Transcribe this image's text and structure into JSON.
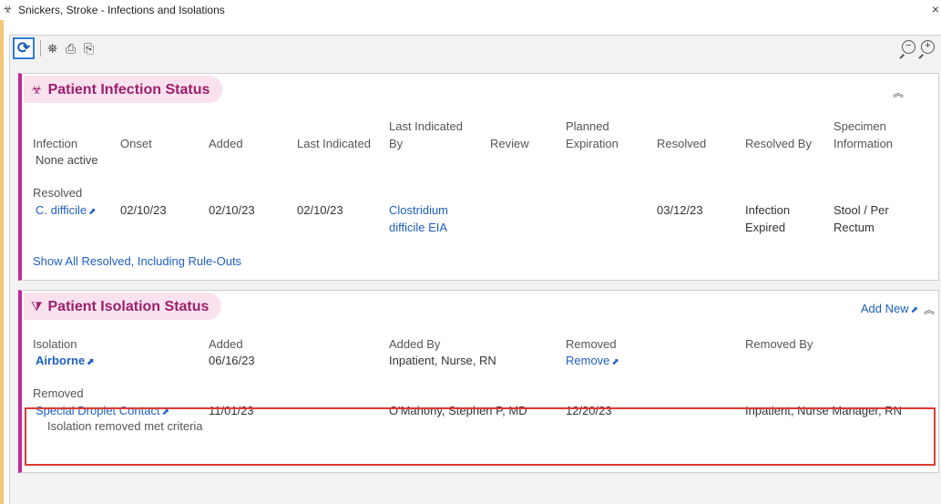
{
  "window": {
    "title": "Snickers, Stroke - Infections and Isolations",
    "title_icon": "biohazard-icon",
    "close_glyph": "×"
  },
  "toolbar": {
    "refresh_glyph": "⟳",
    "find_glyph": "⛯",
    "print_glyph": "⎙",
    "copy_glyph": "⎘",
    "zoom_out_glyph": "−",
    "zoom_in_glyph": "+"
  },
  "infection": {
    "header_icon": "☣",
    "title": "Patient Infection Status",
    "collapse_glyph": "⌃",
    "columns": {
      "infection": "Infection",
      "onset": "Onset",
      "added": "Added",
      "last_indicated": "Last Indicated",
      "last_indicated_by_1": "Last Indicated",
      "last_indicated_by_2": "By",
      "review": "Review",
      "planned_exp_1": "Planned",
      "planned_exp_2": "Expiration",
      "resolved": "Resolved",
      "resolved_by": "Resolved By",
      "specimen_1": "Specimen",
      "specimen_2": "Information"
    },
    "none_active": "None active",
    "resolved_label": "Resolved",
    "row": {
      "infection": "C. difficile",
      "onset": "02/10/23",
      "added": "02/10/23",
      "last_indicated": "02/10/23",
      "by_1": "Clostridium",
      "by_2": "difficile EIA",
      "resolved": "03/12/23",
      "resolved_by_1": "Infection",
      "resolved_by_2": "Expired",
      "specimen_1": "Stool / Per",
      "specimen_2": "Rectum"
    },
    "show_all": "Show All Resolved, Including Rule-Outs"
  },
  "isolation": {
    "header_icon": "⧩",
    "title": "Patient Isolation Status",
    "add_new": "Add New",
    "columns": {
      "isolation": "Isolation",
      "added": "Added",
      "added_by": "Added By",
      "removed": "Removed",
      "removed_by": "Removed By"
    },
    "active_row": {
      "isolation": "Airborne",
      "added": "06/16/23",
      "added_by": "Inpatient, Nurse, RN",
      "remove_link": "Remove"
    },
    "removed_label": "Removed",
    "removed_row": {
      "isolation": "Special Droplet Contact",
      "added": "11/01/23",
      "added_by": "O'Mahony, Stephen P, MD",
      "removed": "12/20/23",
      "removed_by": "Inpatient, Nurse Manager, RN",
      "reason": "Isolation removed met criteria"
    }
  },
  "colors": {
    "accent": "#c4289a",
    "link": "#1e5fbf",
    "highlight": "#e0392f"
  }
}
